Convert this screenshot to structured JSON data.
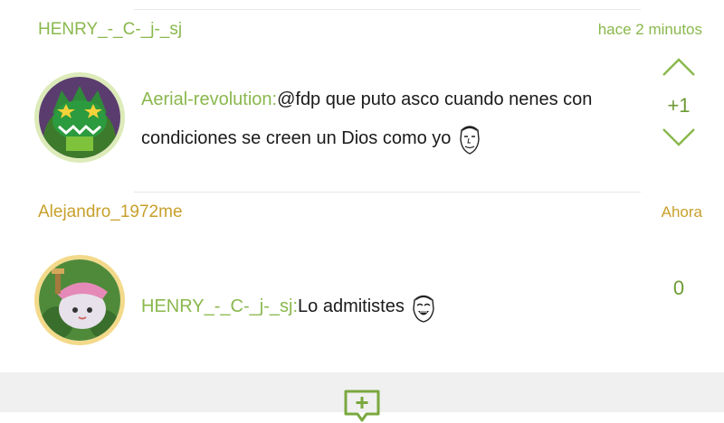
{
  "colors": {
    "accent_green": "#8ab84d",
    "accent_gold": "#c8a02b",
    "score": "#6e9a35",
    "divider": "#e8e8e8",
    "bottom_bar": "#f0f0f0"
  },
  "comments": [
    {
      "author": "HENRY_-_C-_j-_sj",
      "time": "hace 2 minutos",
      "reply_to": "Aerial-revolution:",
      "text": "@fdp que puto asco cuando nenes con condiciones se creen un Dios como yo",
      "score": "+1",
      "avatar_icon": "green-monster-avatar",
      "emote_icon": "yao-ming-meme-icon"
    },
    {
      "author": "Alejandro_1972me",
      "time": "Ahora",
      "reply_to": "HENRY_-_C-_j-_sj:",
      "text": "Lo admitistes",
      "score": "0",
      "avatar_icon": "pink-hat-cat-avatar",
      "emote_icon": "yao-ming-laugh-meme-icon"
    }
  ],
  "footer": {
    "reply_icon": "add-comment-icon"
  }
}
